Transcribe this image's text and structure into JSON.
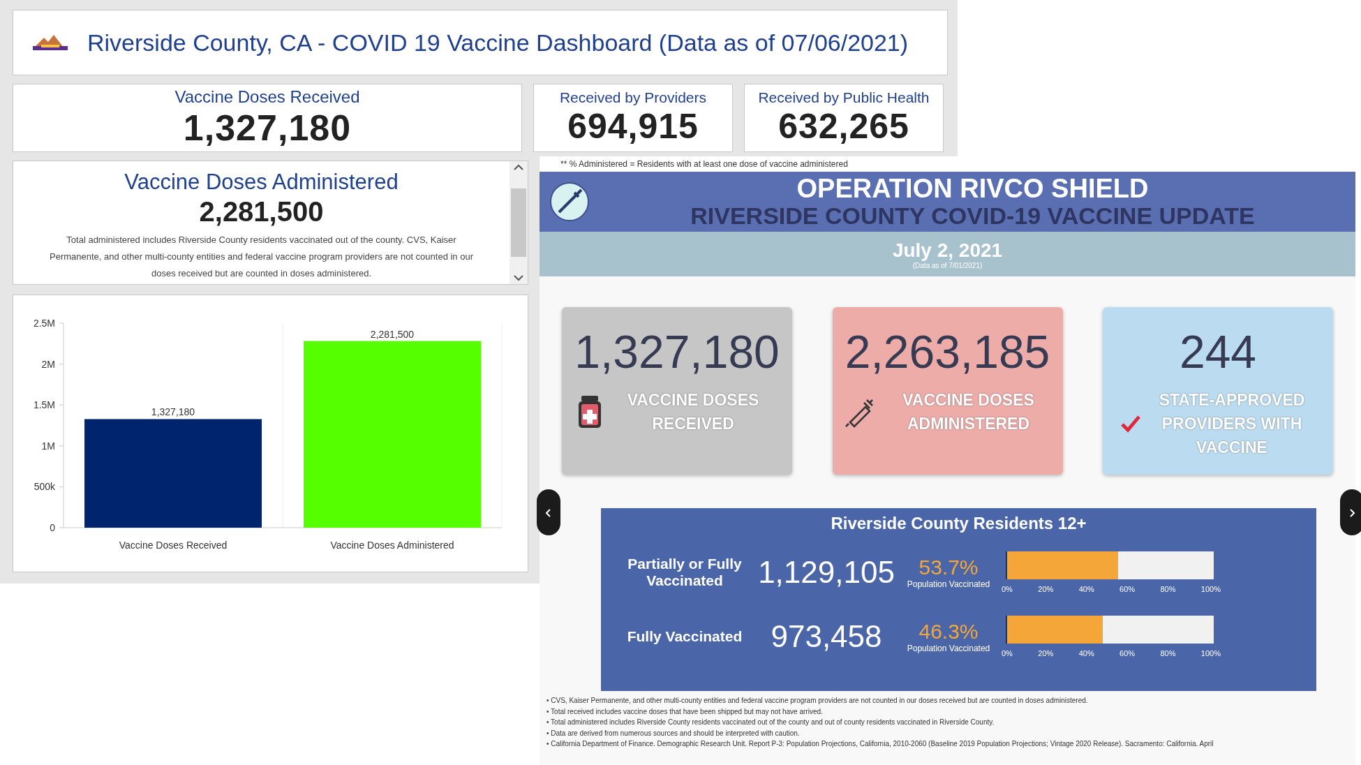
{
  "dashboard": {
    "title": "Riverside County, CA - COVID 19 Vaccine Dashboard (Data as of 07/06/2021)",
    "cards": [
      {
        "label": "Vaccine Doses Received",
        "value": "1,327,180",
        "kind": "wide"
      },
      {
        "label": "Received by Providers",
        "value": "694,915",
        "kind": "small"
      },
      {
        "label": "Received by Public Health",
        "value": "632,265",
        "kind": "small"
      }
    ],
    "administered": {
      "title": "Vaccine Doses Administered",
      "value": "2,281,500",
      "note": "Total administered includes Riverside County residents vaccinated out of the county. CVS, Kaiser Permanente, and other multi-county entities and federal vaccine program providers are not counted in our doses received but are counted in doses administered."
    },
    "chart_data": {
      "type": "bar",
      "categories": [
        "Vaccine Doses Received",
        "Vaccine Doses Administered"
      ],
      "values": [
        1327180,
        2281500
      ],
      "colors": [
        "#00246e",
        "#55ff00"
      ],
      "ylim": [
        0,
        2500000
      ],
      "yticks": [
        {
          "value": 0,
          "label": "0"
        },
        {
          "value": 500000,
          "label": "500k"
        },
        {
          "value": 1000000,
          "label": "1M"
        },
        {
          "value": 1500000,
          "label": "1.5M"
        },
        {
          "value": 2000000,
          "label": "2M"
        },
        {
          "value": 2500000,
          "label": "2.5M"
        }
      ],
      "value_labels": [
        "1,327,180",
        "2,281,500"
      ]
    },
    "footnote": "** % Administered = Residents with at least one dose of vaccine administered"
  },
  "update": {
    "title": "OPERATION RIVCO SHIELD",
    "subtitle": "RIVERSIDE COUNTY COVID-19 VACCINE UPDATE",
    "date": "July 2, 2021",
    "data_as_of": "(Data as of 7/01/2021)",
    "stats": [
      {
        "value": "1,327,180",
        "label": "VACCINE DOSES RECEIVED",
        "kind": "bottle"
      },
      {
        "value": "2,263,185",
        "label": "VACCINE DOSES ADMINISTERED",
        "kind": "syringe"
      },
      {
        "value": "244",
        "label": "STATE-APPROVED PROVIDERS WITH VACCINE",
        "kind": "check"
      }
    ],
    "residents": {
      "title": "Riverside County Residents 12+",
      "rows": [
        {
          "label": "Partially or Fully Vaccinated",
          "value": "1,129,105",
          "percent": "53.7%",
          "caption": "Population Vaccinated",
          "level": 0.537,
          "ticks": [
            "0%",
            "20%",
            "40%",
            "60%",
            "80%",
            "100%"
          ]
        },
        {
          "label": "Fully Vaccinated",
          "value": "973,458",
          "percent": "46.3%",
          "caption": "Population Vaccinated",
          "level": 0.463,
          "ticks": [
            "0%",
            "20%",
            "40%",
            "60%",
            "80%",
            "100%"
          ]
        }
      ]
    },
    "notes": [
      "• CVS, Kaiser Permanente, and other multi-county entities and federal vaccine program providers are not counted in our doses received but are counted in doses administered.",
      "• Total received includes vaccine doses that have been shipped but may not have arrived.",
      "• Total administered includes Riverside County residents vaccinated out of the county and out of county residents vaccinated in Riverside County.",
      "• Data are derived from numerous sources and should be interpreted with caution.",
      "• California Department of Finance. Demographic Research Unit. Report P-3: Population Projections, California, 2010-2060 (Baseline 2019 Population Projections; Vintage 2020 Release). Sacramento: California. April"
    ]
  }
}
